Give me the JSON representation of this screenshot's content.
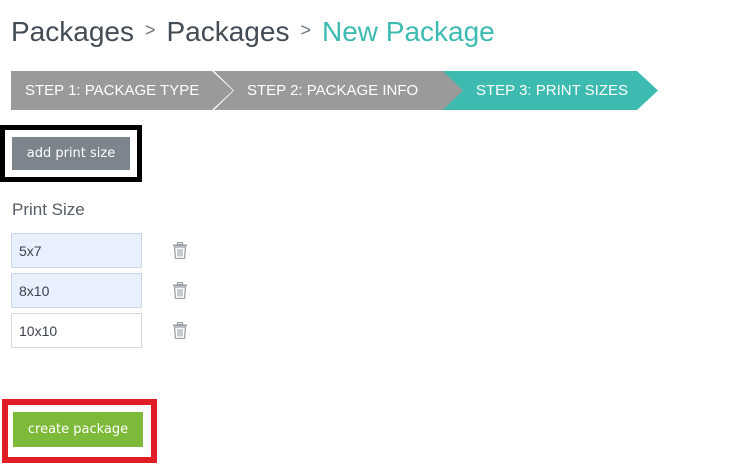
{
  "breadcrumb": {
    "items": [
      "Packages",
      "Packages"
    ],
    "separator": ">",
    "current": "New Package"
  },
  "steps": [
    {
      "label": "STEP 1: PACKAGE TYPE",
      "state": "complete"
    },
    {
      "label": "STEP 2: PACKAGE INFO",
      "state": "complete"
    },
    {
      "label": "STEP 3: PRINT SIZES",
      "state": "active"
    }
  ],
  "actions": {
    "add_label": "add print size",
    "create_label": "create package"
  },
  "print_sizes": {
    "label": "Print Size",
    "rows": [
      {
        "value": "5x7",
        "trash_icon": "trash-icon"
      },
      {
        "value": "8x10",
        "trash_icon": "trash-icon"
      },
      {
        "value": "10x10",
        "trash_icon": "trash-icon"
      }
    ]
  },
  "colors": {
    "accent": "#3dbbb0",
    "step_inactive": "#9a9a9a",
    "add_button": "#7c848d",
    "create_button": "#7dba39",
    "highlight_black": "#000000",
    "highlight_red": "#e01d25"
  }
}
